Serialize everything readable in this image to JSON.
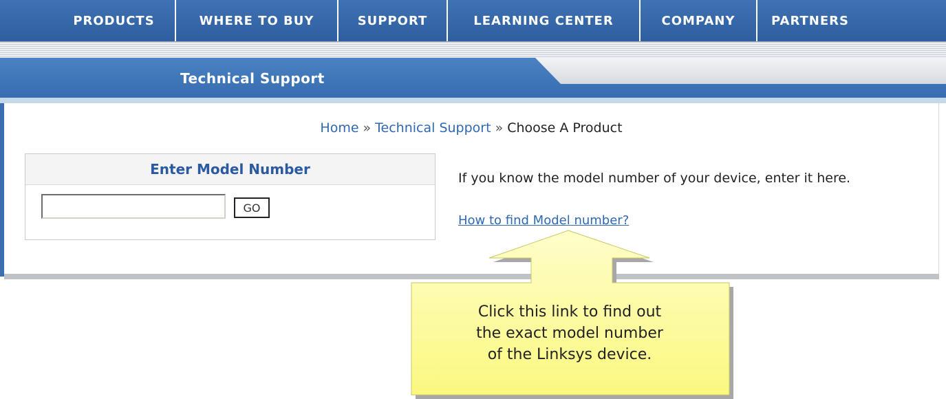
{
  "nav": {
    "items": [
      {
        "label": "PRODUCTS"
      },
      {
        "label": "WHERE TO BUY"
      },
      {
        "label": "SUPPORT"
      },
      {
        "label": "LEARNING CENTER"
      },
      {
        "label": "COMPANY"
      },
      {
        "label": "PARTNERS"
      }
    ]
  },
  "section": {
    "title": "Technical Support"
  },
  "breadcrumb": {
    "home": "Home",
    "separator": "»",
    "support": "Technical Support",
    "current": "Choose A Product"
  },
  "model_box": {
    "title": "Enter Model Number",
    "input_value": "",
    "go_label": "GO"
  },
  "info": {
    "text": "If you know the model number of your device, enter it here.",
    "link": "How to find Model number?"
  },
  "callout": {
    "line1": "Click this link to find out",
    "line2": "the exact model number",
    "line3": "of the Linksys device."
  },
  "colors": {
    "nav_blue": "#2e5e9f",
    "link_blue": "#2f68b0",
    "callout_yellow": "#fdfc9a"
  }
}
